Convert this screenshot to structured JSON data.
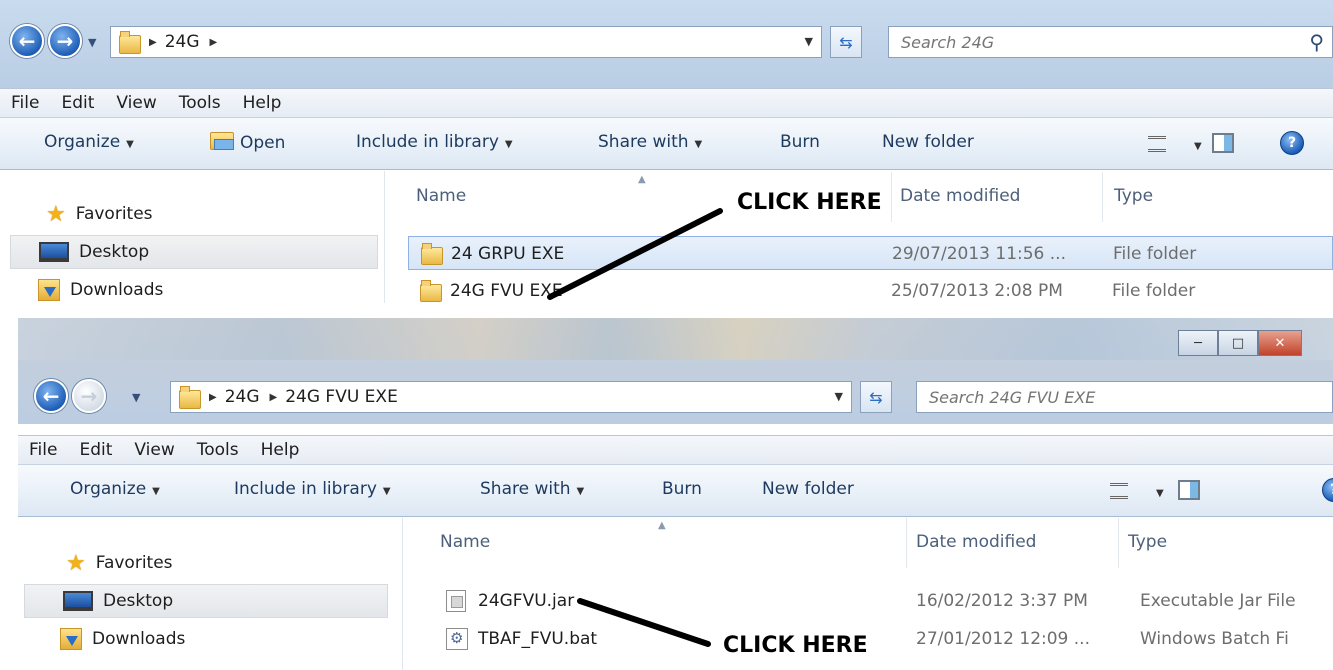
{
  "top_window": {
    "breadcrumb": [
      "24G"
    ],
    "search_placeholder": "Search 24G",
    "menu": [
      "File",
      "Edit",
      "View",
      "Tools",
      "Help"
    ],
    "toolbar": {
      "organize": "Organize",
      "open": "Open",
      "include_in_library": "Include in library",
      "share_with": "Share with",
      "burn": "Burn",
      "new_folder": "New folder"
    },
    "nav": {
      "favorites": "Favorites",
      "desktop": "Desktop",
      "downloads": "Downloads"
    },
    "columns": {
      "name": "Name",
      "date_modified": "Date modified",
      "type": "Type"
    },
    "files": [
      {
        "name": "24 GRPU EXE",
        "date": "29/07/2013 11:56 ...",
        "type": "File folder",
        "icon": "folder-icon"
      },
      {
        "name": "24G FVU EXE",
        "date": "25/07/2013 2:08 PM",
        "type": "File folder",
        "icon": "folder-icon"
      }
    ],
    "annotation": "CLICK HERE"
  },
  "bottom_window": {
    "breadcrumb": [
      "24G",
      "24G FVU EXE"
    ],
    "search_placeholder": "Search 24G FVU EXE",
    "menu": [
      "File",
      "Edit",
      "View",
      "Tools",
      "Help"
    ],
    "toolbar": {
      "organize": "Organize",
      "include_in_library": "Include in library",
      "share_with": "Share with",
      "burn": "Burn",
      "new_folder": "New folder"
    },
    "nav": {
      "favorites": "Favorites",
      "desktop": "Desktop",
      "downloads": "Downloads"
    },
    "columns": {
      "name": "Name",
      "date_modified": "Date modified",
      "type": "Type"
    },
    "files": [
      {
        "name": "24GFVU.jar",
        "date": "16/02/2012 3:37 PM",
        "type": "Executable Jar File",
        "icon": "jar-file-icon"
      },
      {
        "name": "TBAF_FVU.bat",
        "date": "27/01/2012 12:09 ...",
        "type": "Windows Batch Fi",
        "icon": "batch-file-icon"
      }
    ],
    "annotation": "CLICK HERE"
  },
  "colors": {
    "accent": "#2b6cc4",
    "toolbar_text": "#1e3a5f",
    "annotation": "#000000"
  }
}
